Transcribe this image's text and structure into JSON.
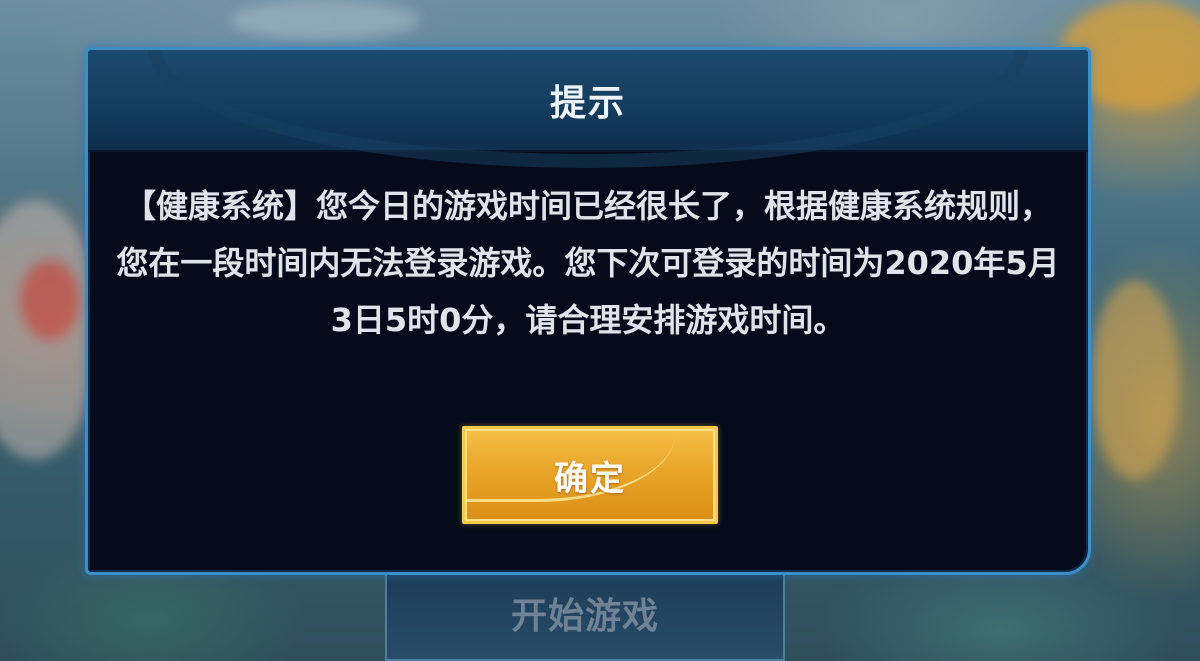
{
  "start_button": {
    "label": "开始游戏"
  },
  "dialog": {
    "title": "提示",
    "message": "【健康系统】您今日的游戏时间已经很长了，根据健康系统规则，您在一段时间内无法登录游戏。您下次可登录的时间为2020年5月3日5时0分，请合理安排游戏时间。",
    "confirm_label": "确定"
  },
  "colors": {
    "dialog_border": "#3b8fc9",
    "dialog_background": "#050b1a",
    "confirm_button": "#e9a52a"
  }
}
